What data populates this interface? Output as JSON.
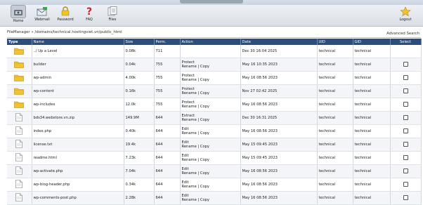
{
  "toolbar": {
    "items": [
      {
        "label": "Home",
        "icon": "home-icon"
      },
      {
        "label": "Webmail",
        "icon": "webmail-icon"
      },
      {
        "label": "Password",
        "icon": "lock-icon"
      },
      {
        "label": "FAQ",
        "icon": "help-icon"
      },
      {
        "label": "Files",
        "icon": "files-icon"
      }
    ],
    "logout": {
      "label": "Logout",
      "icon": "logout-icon"
    }
  },
  "path": "FileManager » /domains/technical.hostingviet.vn/public_html",
  "advanced_search": "Advanced Search",
  "columns": [
    "Type",
    "Name",
    "Size",
    "Perm.",
    "Action",
    "Date",
    "UID",
    "GID",
    "Select"
  ],
  "rows": [
    {
      "type": "folder",
      "name": "../ Up a Level",
      "size": "0.08k",
      "perm": "711",
      "action1": "",
      "action2": "",
      "date": "Dec 30 16:04 2025",
      "uid": "technical",
      "gid": "technical",
      "select": false
    },
    {
      "type": "folder",
      "name": "builder",
      "size": "0.04k",
      "perm": "755",
      "action1": "Protect",
      "action2": "Rename | Copy",
      "date": "May 16 10:35 2023",
      "uid": "technical",
      "gid": "technical",
      "select": true
    },
    {
      "type": "folder",
      "name": "wp-admin",
      "size": "4.00k",
      "perm": "755",
      "action1": "Protect",
      "action2": "Rename | Copy",
      "date": "May 16 08:56 2023",
      "uid": "technical",
      "gid": "technical",
      "select": true
    },
    {
      "type": "folder",
      "name": "wp-content",
      "size": "0.16k",
      "perm": "755",
      "action1": "Protect",
      "action2": "Rename | Copy",
      "date": "Nov 27 02:42 2025",
      "uid": "technical",
      "gid": "technical",
      "select": true
    },
    {
      "type": "folder",
      "name": "wp-includes",
      "size": "12.0k",
      "perm": "755",
      "action1": "Protect",
      "action2": "Rename | Copy",
      "date": "May 16 08:56 2023",
      "uid": "technical",
      "gid": "technical",
      "select": true
    },
    {
      "type": "file",
      "name": "bds34.webstore.vn.zip",
      "size": "149.9M",
      "perm": "644",
      "action1": "Extract",
      "action2": "Rename | Copy",
      "date": "Dec 30 16:31 2025",
      "uid": "technical",
      "gid": "technical",
      "select": true
    },
    {
      "type": "file",
      "name": "index.php",
      "size": "0.40k",
      "perm": "644",
      "action1": "Edit",
      "action2": "Rename | Copy",
      "date": "May 16 08:56 2023",
      "uid": "technical",
      "gid": "technical",
      "select": true
    },
    {
      "type": "file",
      "name": "license.txt",
      "size": "19.4k",
      "perm": "644",
      "action1": "Edit",
      "action2": "Rename | Copy",
      "date": "May 15 09:45 2023",
      "uid": "technical",
      "gid": "technical",
      "select": true
    },
    {
      "type": "file",
      "name": "readme.html",
      "size": "7.23k",
      "perm": "644",
      "action1": "Edit",
      "action2": "Rename | Copy",
      "date": "May 15 09:45 2023",
      "uid": "technical",
      "gid": "technical",
      "select": true
    },
    {
      "type": "file",
      "name": "wp-activate.php",
      "size": "7.04k",
      "perm": "644",
      "action1": "Edit",
      "action2": "Rename | Copy",
      "date": "May 16 08:56 2023",
      "uid": "technical",
      "gid": "technical",
      "select": true
    },
    {
      "type": "file",
      "name": "wp-blog-header.php",
      "size": "0.34k",
      "perm": "644",
      "action1": "Edit",
      "action2": "Rename | Copy",
      "date": "May 16 08:56 2023",
      "uid": "technical",
      "gid": "technical",
      "select": true
    },
    {
      "type": "file",
      "name": "wp-comments-post.php",
      "size": "2.28k",
      "perm": "644",
      "action1": "Edit",
      "action2": "Rename | Copy",
      "date": "May 16 08:56 2023",
      "uid": "technical",
      "gid": "technical",
      "select": true
    }
  ],
  "colors": {
    "header_bg": "#2c4e7e",
    "folder": "#f2c230",
    "accent": "#2c4e7e"
  }
}
